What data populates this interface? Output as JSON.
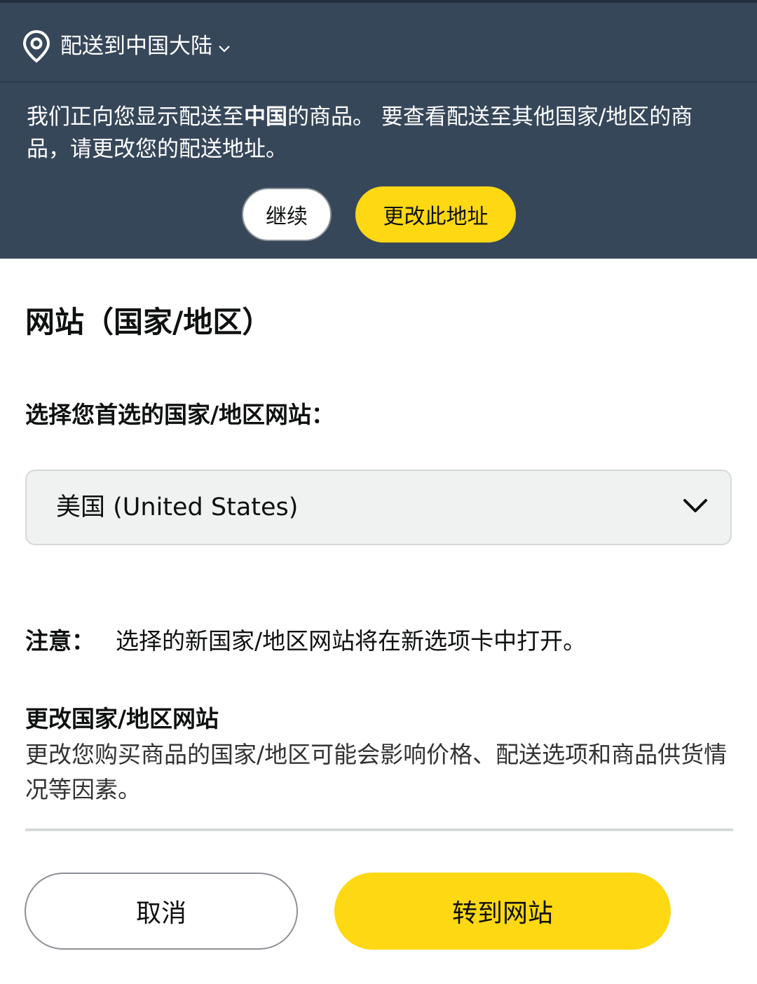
{
  "header": {
    "location_icon": "location-pin-icon",
    "deliver_to": "配送到中国大陆",
    "chevron_icon": "chevron-down-icon"
  },
  "notice": {
    "text_before": "我们正向您显示配送至",
    "country": "中国",
    "text_after": "的商品。 要查看配送至其他国家/地区的商品，请更改您的配送地址。",
    "continue_label": "继续",
    "change_address_label": "更改此地址"
  },
  "main": {
    "section_title": "网站（国家/地区）",
    "select_label": "选择您首选的国家/地区网站：",
    "selected_site": "美国 (United States)",
    "note_label": "注意：",
    "note_text": "选择的新国家/地区网站将在新选项卡中打开。",
    "change_title": "更改国家/地区网站",
    "change_desc": "更改您购买商品的国家/地区可能会影响价格、配送选项和商品供货情况等因素。"
  },
  "actions": {
    "cancel_label": "取消",
    "go_label": "转到网站"
  },
  "colors": {
    "header_bg": "#37475a",
    "primary_button": "#ffd814",
    "select_bg": "#f0f2f2"
  }
}
